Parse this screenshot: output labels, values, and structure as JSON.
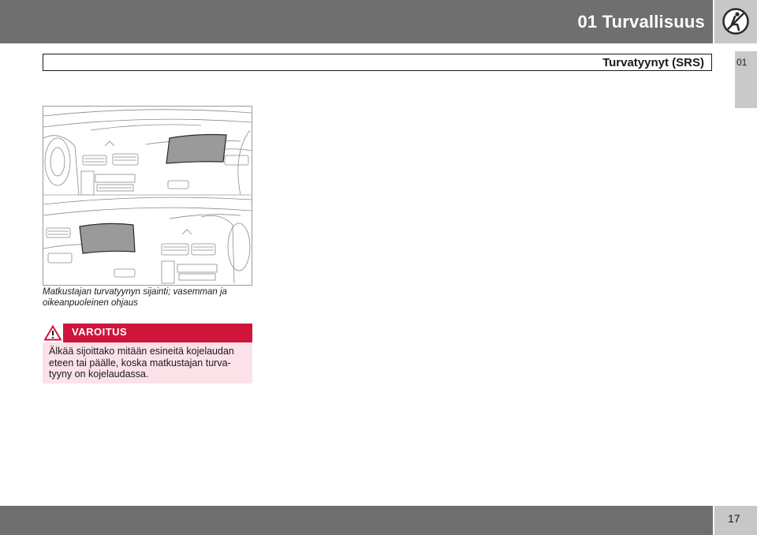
{
  "header": {
    "chapter_title": "01 Turvallisuus",
    "chapter_icon": "no-child-seat-icon",
    "side_tab": "01"
  },
  "section": {
    "title": "Turvatyynyt (SRS)"
  },
  "figure": {
    "illustration": "dashboard-airbag-locations",
    "caption_line1": "Matkustajan turvatyynyn sijainti; vasemman ja",
    "caption_line2": "oikeanpuoleinen ohjaus"
  },
  "warning": {
    "icon": "warning-triangle-icon",
    "label": "VAROITUS",
    "line1": "Älkää sijoittako mitään esineitä kojelaudan",
    "line2": "eteen tai päälle, koska matkustajan turva-",
    "line3": "tyyny on kojelaudassa.",
    "color": "#d0153b",
    "background": "#fbe1e8"
  },
  "footer": {
    "page_number": "17"
  }
}
